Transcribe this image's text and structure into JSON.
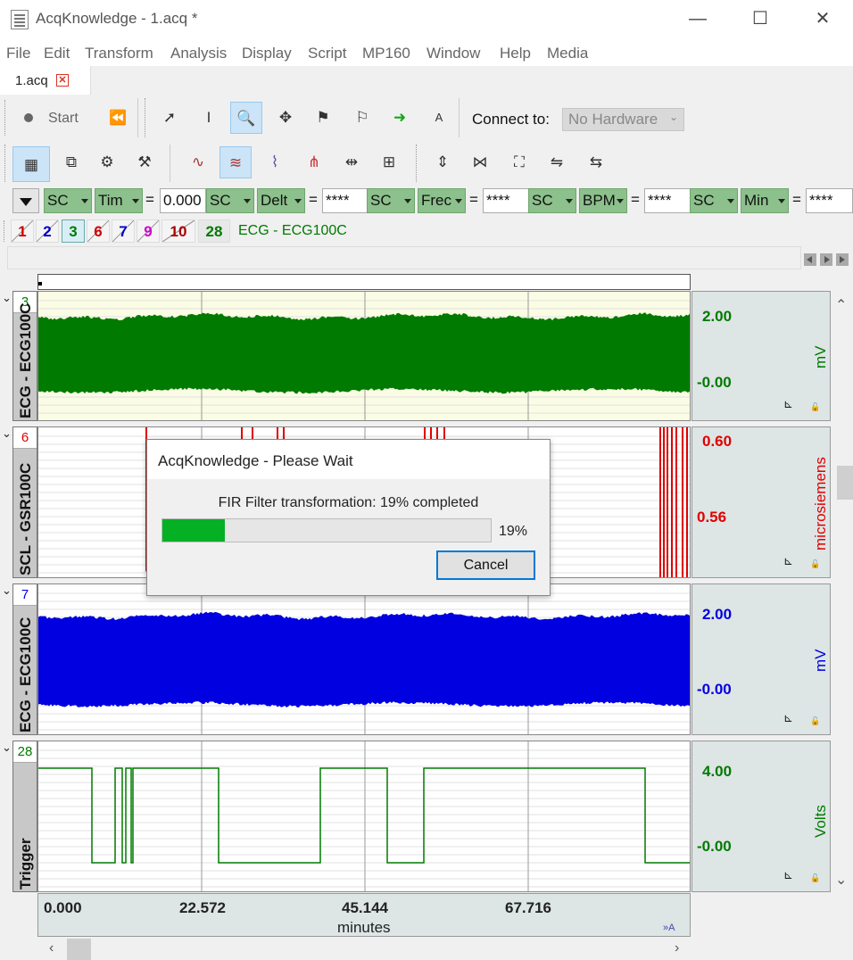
{
  "window": {
    "title": "AcqKnowledge - 1.acq *",
    "minimize": "—",
    "maximize": "☐",
    "close": "✕"
  },
  "menu": [
    "File",
    "Edit",
    "Transform",
    "Analysis",
    "Display",
    "Script",
    "MP160",
    "Window",
    "Help",
    "Media"
  ],
  "tab": {
    "label": "1.acq",
    "close": "✕"
  },
  "toolbar1": {
    "start_label": "Start",
    "connect_label": "Connect to:",
    "hardware_value": "No Hardware"
  },
  "measurements": [
    {
      "channel": "SC",
      "func": "Tim",
      "value": "0.000"
    },
    {
      "channel": "SC",
      "func": "Delt",
      "value": "****"
    },
    {
      "channel": "SC",
      "func": "Frec",
      "value": "****"
    },
    {
      "channel": "SC",
      "func": "BPM",
      "value": "****"
    },
    {
      "channel": "SC",
      "func": "Min",
      "value": "****"
    }
  ],
  "channel_buttons": [
    "1",
    "2",
    "3",
    "6",
    "7",
    "9",
    "10",
    "28"
  ],
  "channel_buttons_colors": [
    "#d00000",
    "#0000c8",
    "#007a00",
    "#d00000",
    "#0000c8",
    "#d000d0",
    "#b00000",
    "#007a00"
  ],
  "active_channel_label": "ECG - ECG100C",
  "channels": [
    {
      "num": "3",
      "name": "ECG - ECG100C",
      "top_val": "2.00",
      "bottom_val": "-0.00",
      "unit": "mV",
      "color": "#007a00"
    },
    {
      "num": "6",
      "name": "SCL - GSR100C",
      "top_val": "0.60",
      "bottom_val": "0.56",
      "unit": "microsiemens",
      "color": "#e00000"
    },
    {
      "num": "7",
      "name": "ECG - ECG100C",
      "top_val": "2.00",
      "bottom_val": "-0.00",
      "unit": "mV",
      "color": "#0000e0"
    },
    {
      "num": "28",
      "name": "Trigger",
      "top_val": "4.00",
      "bottom_val": "-0.00",
      "unit": "Volts",
      "color": "#007a00"
    }
  ],
  "xaxis": {
    "ticks": [
      "0.000",
      "22.572",
      "45.144",
      "67.716"
    ],
    "label": "minutes"
  },
  "dialog": {
    "title": "AcqKnowledge - Please Wait",
    "message": "FIR Filter transformation: 19% completed",
    "progress": 0.19,
    "percent_label": "19%",
    "cancel_label": "Cancel"
  }
}
